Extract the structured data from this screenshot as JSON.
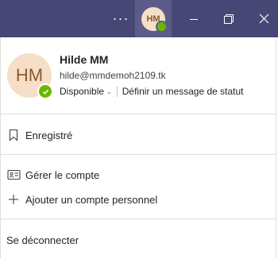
{
  "titlebar": {
    "more_glyph": "···",
    "avatar_initials": "HM",
    "icons": {
      "more": "more-horizontal-icon",
      "minimize": "minimize-icon",
      "maximize": "restore-window-icon",
      "close": "close-icon"
    },
    "background_color": "#464775"
  },
  "profile": {
    "initials": "HM",
    "name": "Hilde MM",
    "email": "hilde@mmdemoh2109.tk",
    "status_label": "Disponible",
    "status_message_link": "Définir un message de statut",
    "presence_color": "#6bb700",
    "avatar_color": "#f6dfc7"
  },
  "menu": {
    "saved": {
      "label": "Enregistré",
      "icon": "bookmark-icon"
    },
    "manage_account": {
      "label": "Gérer le compte",
      "icon": "contact-card-icon"
    },
    "add_personal": {
      "label": "Ajouter un compte personnel",
      "icon": "plus-icon"
    },
    "sign_out": {
      "label": "Se déconnecter"
    }
  }
}
